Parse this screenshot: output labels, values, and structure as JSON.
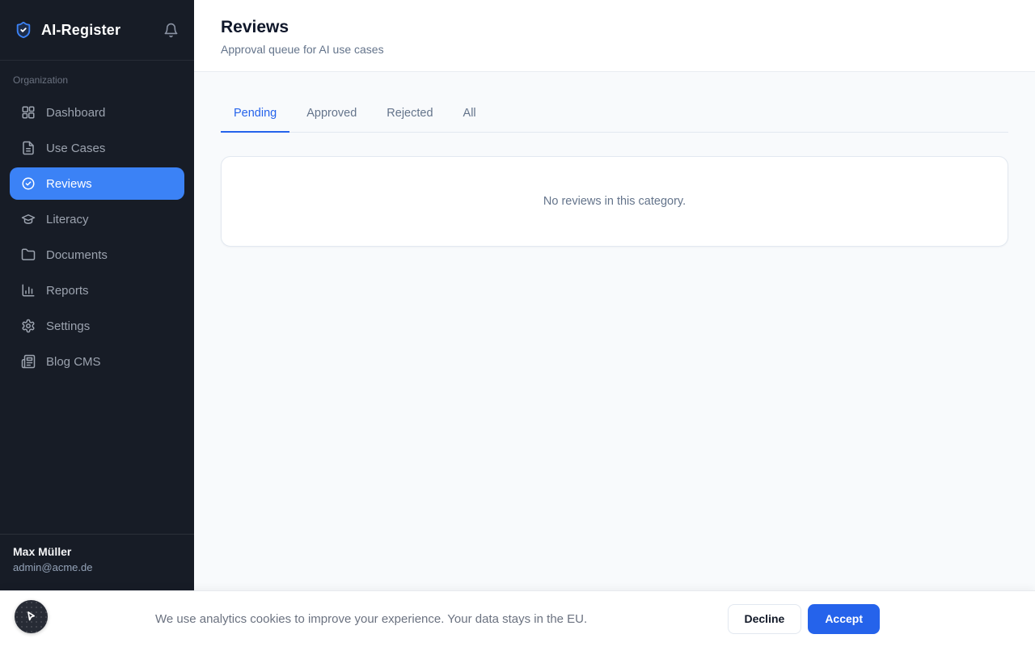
{
  "sidebar": {
    "logo": {
      "text": "AI-Register",
      "icon": "shield-check-icon"
    },
    "section_label": "Organization",
    "items": [
      {
        "label": "Dashboard",
        "icon": "dashboard-grid-icon",
        "active": false
      },
      {
        "label": "Use Cases",
        "icon": "file-text-icon",
        "active": false
      },
      {
        "label": "Reviews",
        "icon": "circle-check-icon",
        "active": true
      },
      {
        "label": "Literacy",
        "icon": "graduation-cap-icon",
        "active": false
      },
      {
        "label": "Documents",
        "icon": "folder-icon",
        "active": false
      },
      {
        "label": "Reports",
        "icon": "bar-chart-icon",
        "active": false
      },
      {
        "label": "Settings",
        "icon": "gear-icon",
        "active": false
      },
      {
        "label": "Blog CMS",
        "icon": "newspaper-icon",
        "active": false
      }
    ],
    "user": {
      "name": "Max Müller",
      "email": "admin@acme.de"
    }
  },
  "header": {
    "title": "Reviews",
    "subtitle": "Approval queue for AI use cases"
  },
  "tabs": [
    {
      "label": "Pending",
      "active": true
    },
    {
      "label": "Approved",
      "active": false
    },
    {
      "label": "Rejected",
      "active": false
    },
    {
      "label": "All",
      "active": false
    }
  ],
  "empty_state": {
    "message": "No reviews in this category."
  },
  "cookie_banner": {
    "message": "We use analytics cookies to improve your experience. Your data stays in the EU.",
    "decline_label": "Decline",
    "accept_label": "Accept"
  },
  "colors": {
    "accent": "#3b82f6",
    "accent_dark": "#2563eb",
    "sidebar_bg": "#171c26",
    "content_bg": "#f8fafc",
    "border": "#e2e8f0",
    "muted_text": "#64748b"
  }
}
